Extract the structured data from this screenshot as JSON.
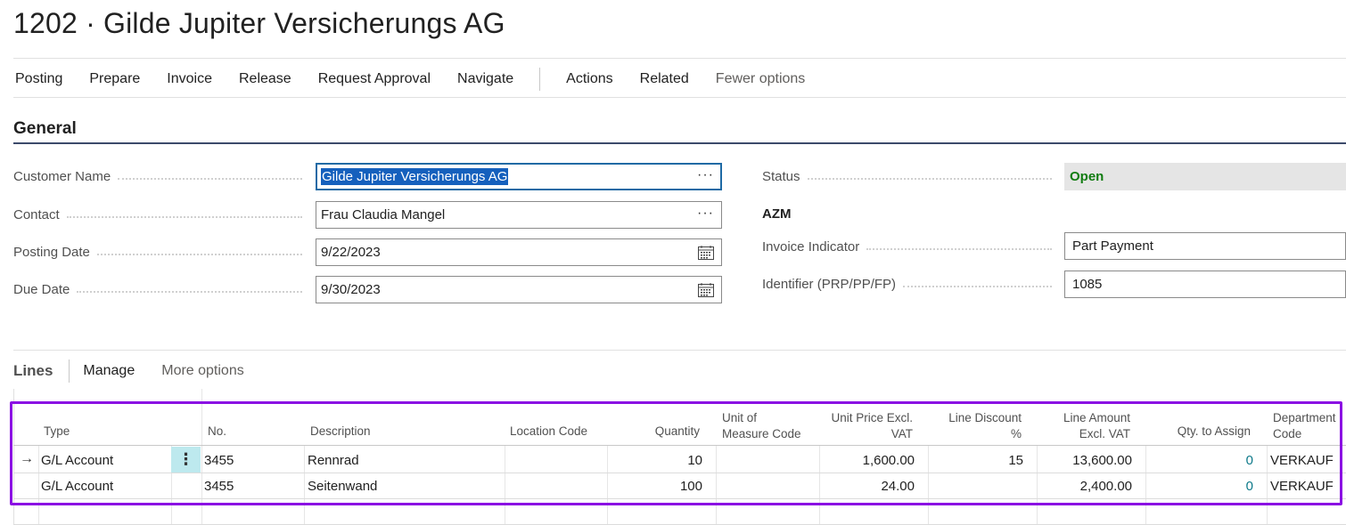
{
  "page": {
    "title": "1202 · Gilde Jupiter Versicherungs AG"
  },
  "actions": {
    "items": [
      "Posting",
      "Prepare",
      "Invoice",
      "Release",
      "Request Approval",
      "Navigate"
    ],
    "items2": [
      "Actions",
      "Related"
    ],
    "fewer_options": "Fewer options"
  },
  "general": {
    "title": "General",
    "customer_name": {
      "label": "Customer Name",
      "value": "Gilde Jupiter Versicherungs AG"
    },
    "contact": {
      "label": "Contact",
      "value": "Frau Claudia Mangel"
    },
    "posting_date": {
      "label": "Posting Date",
      "value": "9/22/2023"
    },
    "due_date": {
      "label": "Due Date",
      "value": "9/30/2023"
    },
    "status": {
      "label": "Status",
      "value": "Open"
    },
    "azm": "AZM",
    "invoice_indicator": {
      "label": "Invoice Indicator",
      "value": "Part Payment"
    },
    "identifier": {
      "label": "Identifier (PRP/PP/FP)",
      "value": "1085"
    },
    "assist_glyph": "···"
  },
  "lines": {
    "title": "Lines",
    "manage": "Manage",
    "more_options": "More options",
    "columns": {
      "type": "Type",
      "no": "No.",
      "description": "Description",
      "location": "Location Code",
      "quantity": "Quantity",
      "uom_1": "Unit of",
      "uom_2": "Measure Code",
      "unit_price_1": "Unit Price Excl.",
      "unit_price_2": "VAT",
      "discount_1": "Line Discount",
      "discount_2": "%",
      "amount_1": "Line Amount",
      "amount_2": "Excl. VAT",
      "qty_assign": "Qty. to Assign",
      "dept_1": "Department",
      "dept_2": "Code"
    },
    "rows": [
      {
        "type": "G/L Account",
        "no": "3455",
        "description": "Rennrad",
        "location": "",
        "quantity": "10",
        "uom": "",
        "unit_price": "1,600.00",
        "discount": "15",
        "amount": "13,600.00",
        "qty_assign": "0",
        "dept": "VERKAUF"
      },
      {
        "type": "G/L Account",
        "no": "3455",
        "description": "Seitenwand",
        "location": "",
        "quantity": "100",
        "uom": "",
        "unit_price": "24.00",
        "discount": "",
        "amount": "2,400.00",
        "qty_assign": "0",
        "dept": "VERKAUF"
      }
    ],
    "row_arrow": "→",
    "row_menu": "⋮"
  },
  "colors": {
    "accent_highlight": "#8b10e3",
    "status_open": "#107c10",
    "selection": "#1560bd"
  }
}
